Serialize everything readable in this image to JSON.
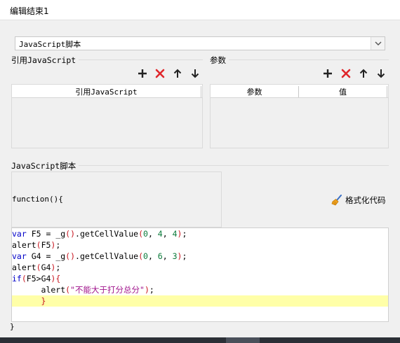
{
  "window": {
    "title": "编辑结束1"
  },
  "script_select": {
    "value": "JavaScript脚本"
  },
  "ref_js": {
    "group_label": "引用JavaScript",
    "column_header": "引用JavaScript"
  },
  "params": {
    "group_label": "参数",
    "columns": [
      "参数",
      "值"
    ]
  },
  "toolbar": {
    "icons": [
      "add-icon",
      "delete-icon",
      "move-up-icon",
      "move-down-icon"
    ],
    "delete_color": "#e0262b"
  },
  "script_editor": {
    "group_label": "JavaScript脚本",
    "function_header": "function(){",
    "format_button": "格式化代码",
    "closing_brace": "}",
    "code_lines": [
      "var F5 = _g().getCellValue(0, 4, 4);",
      "alert(F5);",
      "var G4 = _g().getCellValue(0, 6, 3);",
      "alert(G4);",
      "if(F5>G4){",
      "      alert(\"不能大于打分总分\");",
      "      }"
    ],
    "highlighted_line": 7,
    "colors": {
      "keyword": "#0000c8",
      "number": "#0a7a3a",
      "string": "#a0148c",
      "bracket": "#c8141e",
      "highlight": "#ffffa8"
    }
  }
}
